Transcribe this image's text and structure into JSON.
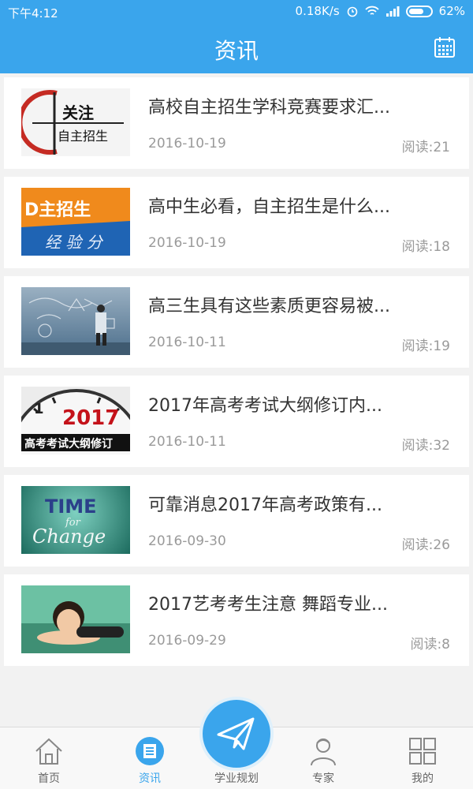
{
  "status_bar": {
    "time": "下午4:12",
    "speed": "0.18K/s",
    "battery": "62%"
  },
  "header": {
    "title": "资讯",
    "calendar_icon": "calendar-icon"
  },
  "articles": [
    {
      "title": "高校自主招生学科竞赛要求汇...",
      "date": "2016-10-19",
      "reads": "阅读:21",
      "thumb_text": "关注 自主招生"
    },
    {
      "title": "高中生必看，自主招生是什么...",
      "date": "2016-10-19",
      "reads": "阅读:18",
      "thumb_text": "自主招生 经验分"
    },
    {
      "title": "高三生具有这些素质更容易被...",
      "date": "2016-10-11",
      "reads": "阅读:19",
      "thumb_text": ""
    },
    {
      "title": "2017年高考考试大纲修订内...",
      "date": "2016-10-11",
      "reads": "阅读:32",
      "thumb_text": "2017 高考考试大纲修订"
    },
    {
      "title": "可靠消息2017年高考政策有...",
      "date": "2016-09-30",
      "reads": "阅读:26",
      "thumb_text": "TIME for Change"
    },
    {
      "title": "2017艺考考生注意 舞蹈专业...",
      "date": "2016-09-29",
      "reads": "阅读:8",
      "thumb_text": ""
    }
  ],
  "bottom_nav": {
    "home": "首页",
    "news": "资讯",
    "planning": "学业规划",
    "experts": "专家",
    "mine": "我的"
  },
  "colors": {
    "primary": "#3aa5ec",
    "text": "#333333",
    "muted": "#9a9a9a",
    "background": "#f2f2f2"
  }
}
